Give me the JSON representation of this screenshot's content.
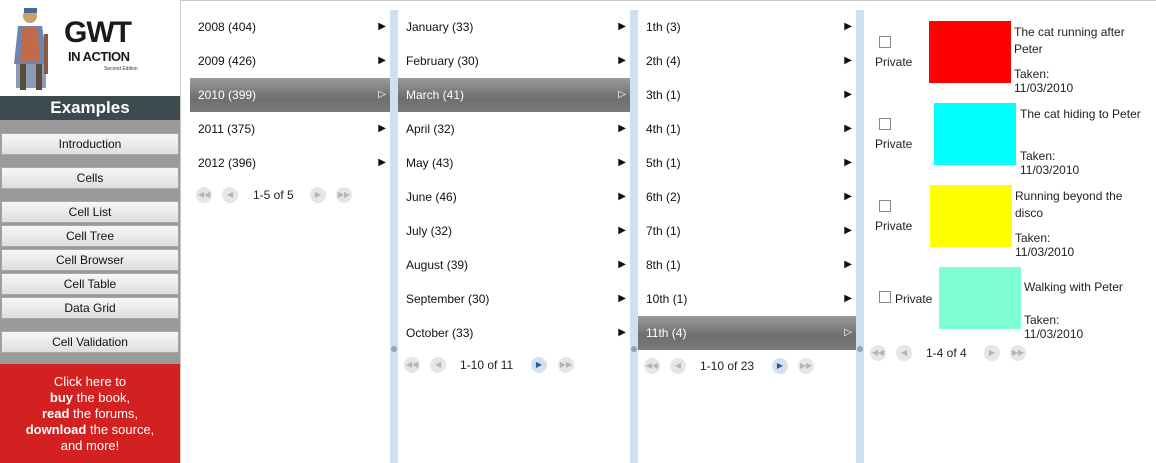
{
  "sidebar": {
    "logo": {
      "title": "GWT",
      "subtitle": "IN ACTION",
      "edition": "Second Edition"
    },
    "header": "Examples",
    "items": [
      {
        "label": "Introduction"
      },
      {
        "label": "Cells"
      },
      {
        "label": "Cell List"
      },
      {
        "label": "Cell Tree"
      },
      {
        "label": "Cell Browser"
      },
      {
        "label": "Cell Table"
      },
      {
        "label": "Data Grid"
      },
      {
        "label": "Cell Validation"
      }
    ],
    "promo": {
      "line1": "Click here to",
      "buy": "buy",
      "buy_rest": " the book,",
      "read": "read",
      "read_rest": " the forums,",
      "download": "download",
      "download_rest": " the source,",
      "line5": "and more!"
    }
  },
  "browser": {
    "years": {
      "items": [
        {
          "label": "2008 (404)",
          "selected": false
        },
        {
          "label": "2009 (426)",
          "selected": false
        },
        {
          "label": "2010 (399)",
          "selected": true
        },
        {
          "label": "2011 (375)",
          "selected": false
        },
        {
          "label": "2012 (396)",
          "selected": false
        }
      ],
      "pager": "1-5 of 5"
    },
    "months": {
      "items": [
        {
          "label": "January (33)",
          "selected": false
        },
        {
          "label": "February (30)",
          "selected": false
        },
        {
          "label": "March (41)",
          "selected": true
        },
        {
          "label": "April (32)",
          "selected": false
        },
        {
          "label": "May (43)",
          "selected": false
        },
        {
          "label": "June (46)",
          "selected": false
        },
        {
          "label": "July (32)",
          "selected": false
        },
        {
          "label": "August (39)",
          "selected": false
        },
        {
          "label": "September (30)",
          "selected": false
        },
        {
          "label": "October (33)",
          "selected": false
        }
      ],
      "pager": "1-10 of 11"
    },
    "days": {
      "items": [
        {
          "label": "1th (3)",
          "selected": false
        },
        {
          "label": "2th (4)",
          "selected": false
        },
        {
          "label": "3th (1)",
          "selected": false
        },
        {
          "label": "4th (1)",
          "selected": false
        },
        {
          "label": "5th (1)",
          "selected": false
        },
        {
          "label": "6th (2)",
          "selected": false
        },
        {
          "label": "7th (1)",
          "selected": false
        },
        {
          "label": "8th (1)",
          "selected": false
        },
        {
          "label": "10th (1)",
          "selected": false
        },
        {
          "label": "11th (4)",
          "selected": true
        }
      ],
      "pager": "1-10 of 23"
    },
    "photos": {
      "items": [
        {
          "private_label": "Private",
          "title": "The cat running after Peter",
          "taken": "Taken: 11/03/2010",
          "color": "#ff0000"
        },
        {
          "private_label": "Private",
          "title": "The cat hiding to Peter",
          "taken": "Taken: 11/03/2010",
          "color": "#00ffff"
        },
        {
          "private_label": "Private",
          "title": "Running beyond the disco",
          "taken": "Taken: 11/03/2010",
          "color": "#ffff00"
        },
        {
          "private_label": "Private",
          "title": "Walking with Peter",
          "taken": "Taken: 11/03/2010",
          "color": "#7fffd4"
        }
      ],
      "pager": "1-4 of 4"
    }
  },
  "icons": {
    "arrow": "right-triangle-icon",
    "pager_first": "first-page-icon",
    "pager_prev": "previous-page-icon",
    "pager_next": "next-page-icon",
    "pager_last": "last-page-icon"
  }
}
